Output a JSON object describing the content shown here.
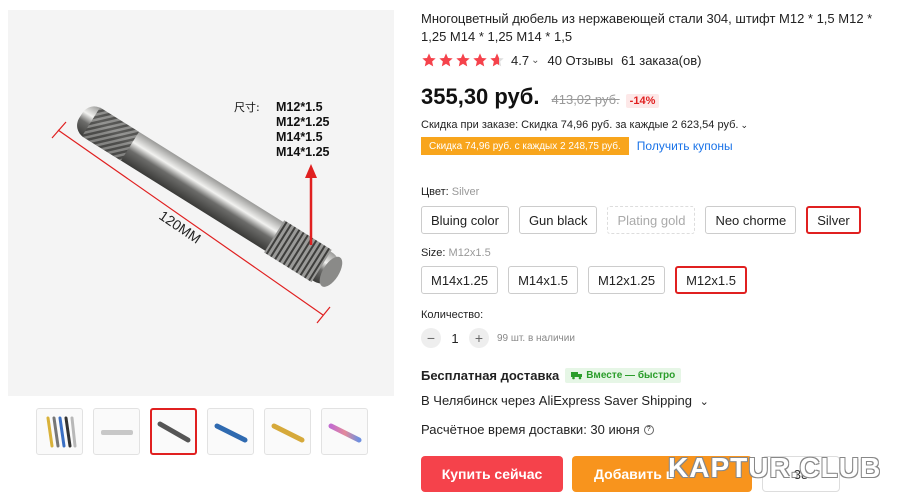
{
  "product": {
    "title": "Многоцветный дюбель из нержавеющей стали 304, штифт M12 * 1,5 M12 * 1,25 M14 * 1,25 M14 * 1,5",
    "rating": "4.7",
    "reviews": "40 Отзывы",
    "orders": "61 заказа(ов)"
  },
  "price": {
    "current": "355,30 руб.",
    "old": "413,02 руб.",
    "discount": "-14%"
  },
  "promo": {
    "order_discount": "Скидка при заказе: Скидка 74,96 руб. за каждые 2 623,54 руб.",
    "coupon_tag": "Скидка 74,96 руб. с каждых 2 248,75 руб.",
    "coupon_link": "Получить купоны"
  },
  "color": {
    "label": "Цвет:",
    "selected": "Silver",
    "options": [
      "Bluing color",
      "Gun black",
      "Plating gold",
      "Neo chorme",
      "Silver"
    ]
  },
  "size": {
    "label": "Size:",
    "selected": "M12x1.5",
    "options": [
      "M14x1.25",
      "M14x1.5",
      "M12x1.25",
      "M12x1.5"
    ]
  },
  "quantity": {
    "label": "Количество:",
    "value": "1",
    "minus": "−",
    "plus": "+",
    "stock": "99 шт. в наличии"
  },
  "shipping": {
    "title": "Бесплатная доставка",
    "badge": "Вместе — быстро",
    "line": "В Челябинск через AliExpress Saver Shipping",
    "eta": "Расчётное время доставки: 30 июня"
  },
  "actions": {
    "buy": "Купить сейчас",
    "cart": "Добавить в",
    "wish_count": "38"
  },
  "image_annotations": {
    "size_label": "尺寸:",
    "sizes": [
      "M12*1.5",
      "M12*1.25",
      "M14*1.5",
      "M14*1.25"
    ],
    "length": "120MM"
  },
  "watermark": "KAPTUR.CLUB",
  "colors": {
    "accent_red": "#e02020",
    "buy_button": "#f5424b",
    "cart_button": "#f8941d",
    "coupon_orange": "#f8a51c",
    "link_blue": "#1a73e8",
    "star": "#f5424b"
  }
}
